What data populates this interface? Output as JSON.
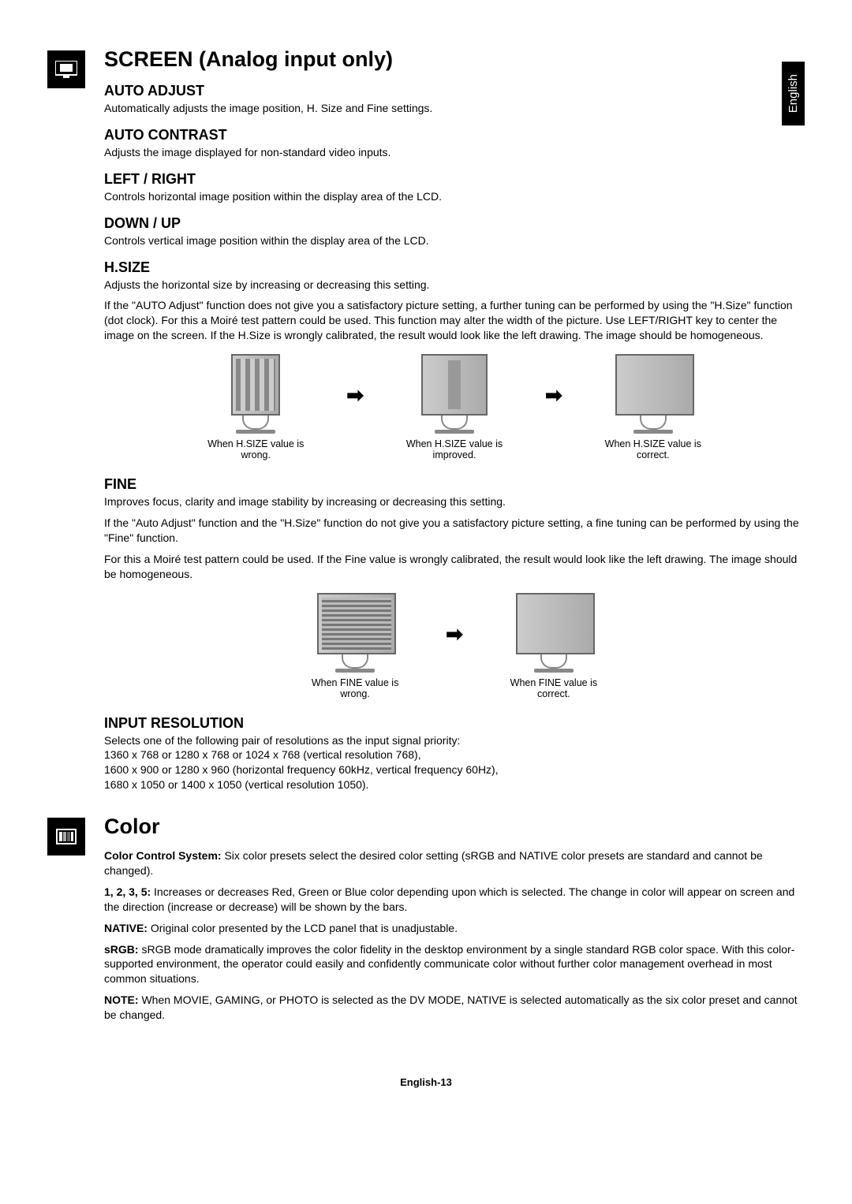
{
  "language_tab": "English",
  "screen": {
    "title": "SCREEN (Analog input only)",
    "auto_adjust": {
      "heading": "AUTO ADJUST",
      "body": "Automatically adjusts the image position, H. Size and Fine settings."
    },
    "auto_contrast": {
      "heading": "AUTO CONTRAST",
      "body": "Adjusts the image displayed for non-standard video inputs."
    },
    "left_right": {
      "heading": "LEFT / RIGHT",
      "body": "Controls horizontal image position within the display area of the LCD."
    },
    "down_up": {
      "heading": "DOWN / UP",
      "body": "Controls vertical image position within the display area of the LCD."
    },
    "hsize": {
      "heading": "H.SIZE",
      "body1": "Adjusts the horizontal size by increasing or decreasing this setting.",
      "body2": "If the \"AUTO Adjust\" function does not give you a satisfactory picture setting, a further tuning can be performed by using the \"H.Size\" function (dot clock). For this a Moiré test pattern could be used. This function may alter the width of the picture. Use LEFT/RIGHT key to center the image on the screen. If the H.Size is wrongly calibrated, the result would look like the left drawing. The image should be homogeneous.",
      "captions": {
        "wrong": "When H.SIZE value is wrong.",
        "improved": "When H.SIZE value is improved.",
        "correct": "When H.SIZE value is correct."
      }
    },
    "fine": {
      "heading": "FINE",
      "body1": "Improves focus, clarity and image stability by increasing or decreasing this setting.",
      "body2": "If the \"Auto Adjust\" function and the \"H.Size\" function do not give you a satisfactory picture setting, a fine tuning can be performed by using the \"Fine\" function.",
      "body3": "For this a Moiré test pattern could be used. If the Fine value is wrongly calibrated, the result would look like the left drawing. The image should be homogeneous.",
      "captions": {
        "wrong": "When FINE value is wrong.",
        "correct": "When FINE value is correct."
      }
    },
    "input_resolution": {
      "heading": "INPUT RESOLUTION",
      "line1": "Selects one of the following pair of resolutions as the input signal priority:",
      "line2": "1360 x 768 or 1280 x 768 or 1024 x 768 (vertical resolution 768),",
      "line3": "1600 x 900 or 1280 x 960 (horizontal frequency 60kHz, vertical frequency 60Hz),",
      "line4": "1680 x 1050 or 1400 x 1050 (vertical resolution 1050)."
    }
  },
  "color": {
    "title": "Color",
    "ccs_label": "Color Control System:",
    "ccs_body": " Six color presets select the desired color setting (sRGB and NATIVE color presets are standard and cannot be changed).",
    "nums_label": "1, 2, 3, 5:",
    "nums_body": " Increases or decreases Red, Green or Blue color depending upon which is selected. The change in color will appear on screen and the direction (increase or decrease) will be shown by the bars.",
    "native_label": "NATIVE:",
    "native_body": " Original color presented by the LCD panel that is unadjustable.",
    "srgb_label": "sRGB:",
    "srgb_body": " sRGB mode dramatically improves the color fidelity in the desktop environment by a single standard RGB color space. With this color-supported environment, the operator could easily and confidently communicate color without further color management overhead in most common situations.",
    "note_label": "NOTE:",
    "note_body": " When MOVIE, GAMING, or PHOTO is selected as the DV MODE, NATIVE is selected automatically as the six color preset and cannot be changed."
  },
  "footer": "English-13"
}
